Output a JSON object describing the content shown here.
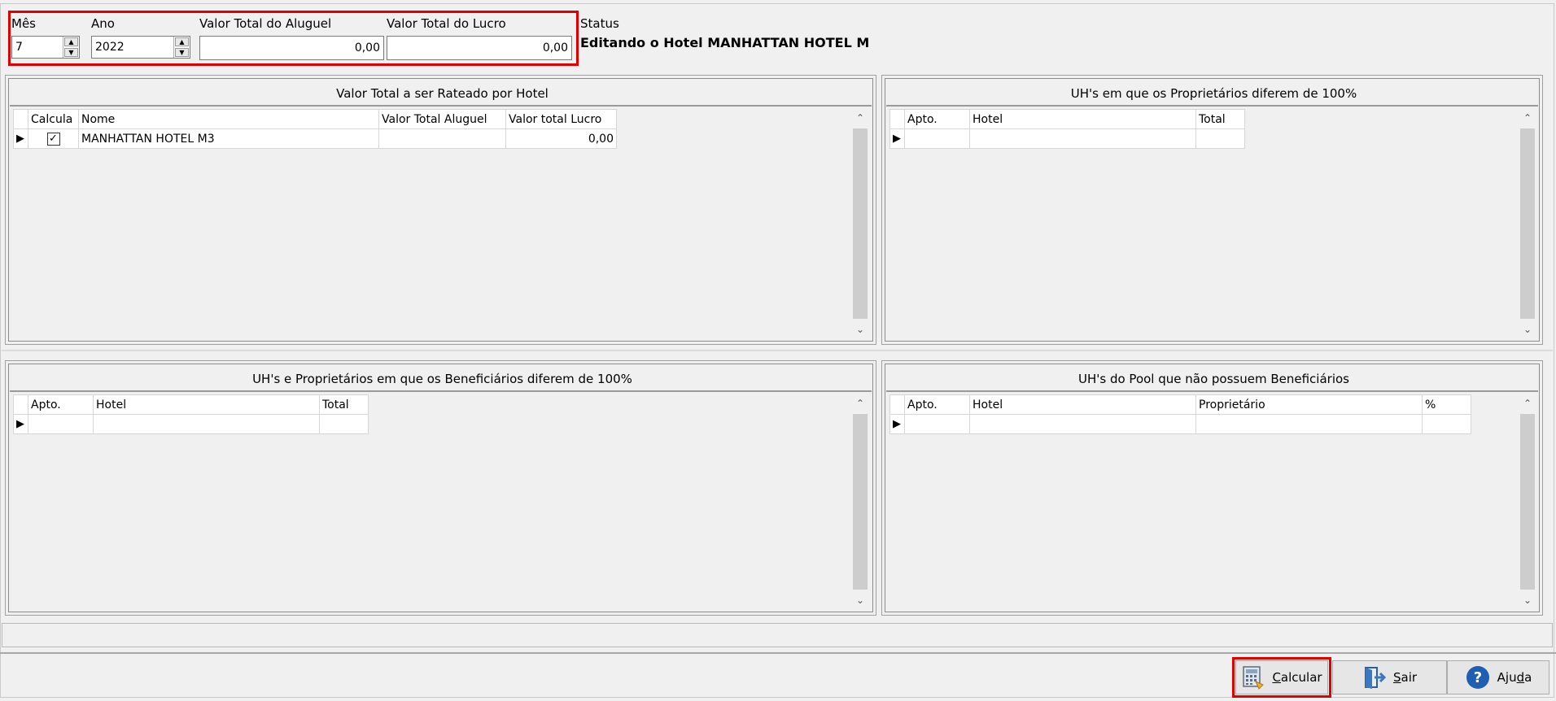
{
  "filters": {
    "mes_label": "Mês",
    "mes_value": "7",
    "ano_label": "Ano",
    "ano_value": "2022",
    "aluguel_label": "Valor Total do Aluguel",
    "aluguel_value": "0,00",
    "lucro_label": "Valor Total do Lucro",
    "lucro_value": "0,00"
  },
  "status": {
    "label": "Status",
    "text": "Editando o Hotel MANHATTAN HOTEL M"
  },
  "panel_rateio": {
    "title": "Valor Total a ser Rateado por Hotel",
    "columns": [
      "Calcula",
      "Nome",
      "Valor Total Aluguel",
      "Valor total Lucro"
    ],
    "rows": [
      {
        "calcula": "✓",
        "nome": "MANHATTAN HOTEL M3",
        "aluguel": "",
        "lucro": "0,00"
      }
    ]
  },
  "panel_proprietarios": {
    "title": "UH's em que os Proprietários diferem de 100%",
    "columns": [
      "Apto.",
      "Hotel",
      "Total"
    ]
  },
  "panel_beneficiarios": {
    "title": "UH's e Proprietários em que os Beneficiários diferem de 100%",
    "columns": [
      "Apto.",
      "Hotel",
      "Total"
    ]
  },
  "panel_pool": {
    "title": "UH's do Pool que não possuem Beneficiários",
    "columns": [
      "Apto.",
      "Hotel",
      "Proprietário",
      "%"
    ]
  },
  "buttons": {
    "calcular_pre": "",
    "calcular_ul": "C",
    "calcular_post": "alcular",
    "sair_pre": "",
    "sair_ul": "S",
    "sair_post": "air",
    "ajuda_pre": "Aju",
    "ajuda_ul": "d",
    "ajuda_post": "a"
  },
  "icons": {
    "calcular": "calculator-icon",
    "sair": "exit-door-icon",
    "ajuda": "help-question-icon"
  },
  "colors": {
    "highlight": "#e00000",
    "help_blue": "#1e5fb4",
    "exit_blue": "#3a78c2"
  }
}
